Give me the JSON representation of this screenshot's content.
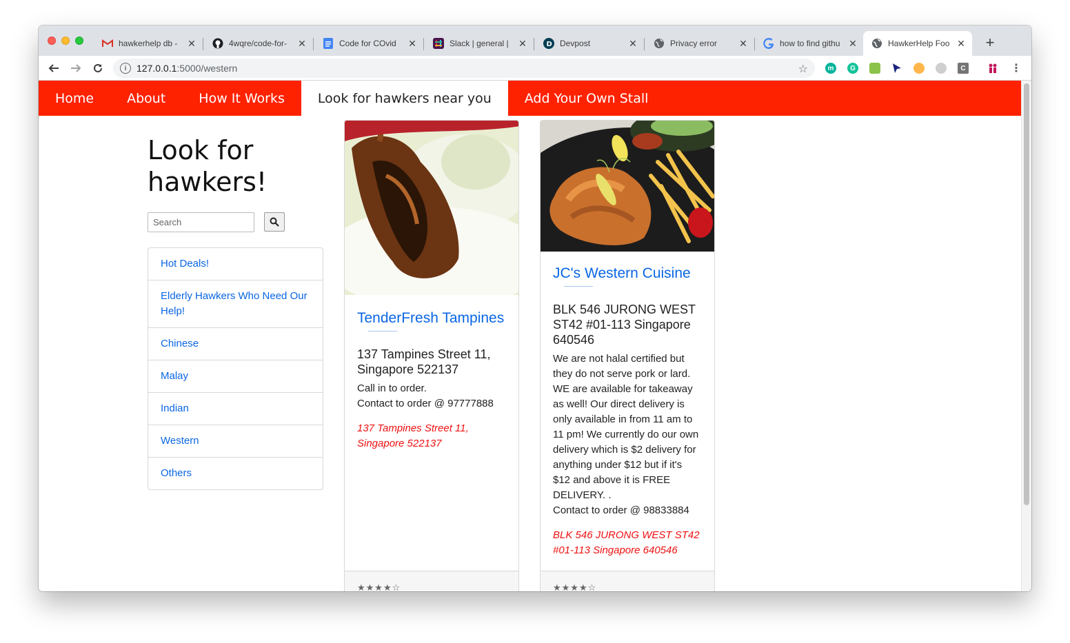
{
  "browser": {
    "tabs": [
      {
        "title": "hawkerhelp db -",
        "icon": "gmail-icon",
        "active": false
      },
      {
        "title": "4wqre/code-for-",
        "icon": "github-icon",
        "active": false
      },
      {
        "title": "Code for COvid",
        "icon": "docs-icon",
        "active": false
      },
      {
        "title": "Slack | general |",
        "icon": "slack-icon",
        "active": false
      },
      {
        "title": "Devpost",
        "icon": "devpost-icon",
        "active": false
      },
      {
        "title": "Privacy error",
        "icon": "globe-icon",
        "active": false
      },
      {
        "title": "how to find githu",
        "icon": "google-icon",
        "active": false
      },
      {
        "title": "HawkerHelp Foo",
        "icon": "globe-icon",
        "active": true
      }
    ],
    "url": {
      "host": "127.0.0.1",
      "path": ":5000/western"
    }
  },
  "navbar": {
    "items": [
      {
        "label": "Home",
        "active": false
      },
      {
        "label": "About",
        "active": false
      },
      {
        "label": "How It Works",
        "active": false
      },
      {
        "label": "Look for hawkers near you",
        "active": true
      },
      {
        "label": "Add Your Own Stall",
        "active": false
      }
    ],
    "color": "#ff2200"
  },
  "sidebar": {
    "heading": "Look for hawkers!",
    "search_placeholder": "Search",
    "categories": [
      "Hot Deals!",
      "Elderly Hawkers Who Need Our Help!",
      "Chinese",
      "Malay",
      "Indian",
      "Western",
      "Others"
    ]
  },
  "cards": [
    {
      "title": "TenderFresh Tampines",
      "address": "137 Tampines Street 11, Singapore 522137",
      "description_lines": [
        "Call in to order.",
        "Contact to order @ 97777888"
      ],
      "location": "137 Tampines Street 11, Singapore 522137",
      "rating": "★★★★☆"
    },
    {
      "title": "JC's Western Cuisine",
      "address": "BLK 546 JURONG WEST ST42 #01-113 Singapore 640546",
      "description_lines": [
        "We are not halal certified but they do not serve pork or lard. WE are available for takeaway as well! Our direct delivery is only available in from 11 am to 11 pm! We currently do our own delivery which is $2 delivery for anything under $12 but if it's $12 and above it is FREE DELIVERY. .",
        "Contact to order @ 98833884"
      ],
      "location": "BLK 546 JURONG WEST ST42 #01-113 Singapore 640546",
      "rating": "★★★★☆"
    }
  ],
  "colors": {
    "link": "#0a66e4",
    "location": "#ee1111"
  }
}
